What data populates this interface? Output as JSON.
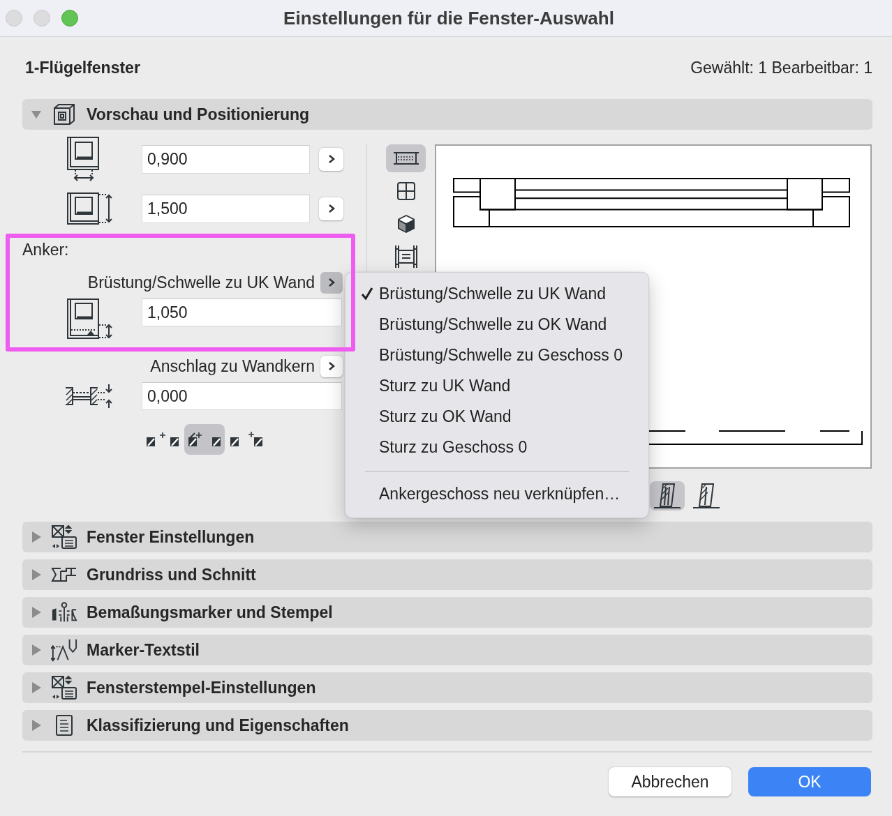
{
  "window": {
    "title": "Einstellungen für die Fenster-Auswahl",
    "buttons": [
      {
        "kind": "close",
        "enabled": false
      },
      {
        "kind": "minimize",
        "enabled": false
      },
      {
        "kind": "zoom",
        "enabled": true
      }
    ]
  },
  "header": {
    "element_name": "1-Flügelfenster",
    "selection_info": "Gewählt: 1 Bearbeitbar: 1"
  },
  "sections": [
    {
      "title": "Vorschau und Positionierung",
      "expanded": true
    },
    {
      "title": "Fenster Einstellungen",
      "expanded": false
    },
    {
      "title": "Grundriss und Schnitt",
      "expanded": false
    },
    {
      "title": "Bemaßungsmarker und Stempel",
      "expanded": false
    },
    {
      "title": "Marker-Textstil",
      "expanded": false
    },
    {
      "title": "Fensterstempel-Einstellungen",
      "expanded": false
    },
    {
      "title": "Klassifizierung und Eigenschaften",
      "expanded": false
    }
  ],
  "positioning": {
    "width": {
      "value": "0,900"
    },
    "height": {
      "value": "1,500"
    },
    "anchor": {
      "label": "Anker:",
      "mode": "Brüstung/Schwelle zu UK Wand",
      "menu_open": true,
      "value": "1,050"
    },
    "reveal": {
      "mode": "Anschlag zu Wandkern",
      "menu_open": false,
      "value": "0,000",
      "options": [
        {
          "selected": false
        },
        {
          "selected": true
        },
        {
          "selected": false
        }
      ]
    }
  },
  "view_modes": [
    {
      "selected": true
    },
    {
      "selected": false
    },
    {
      "selected": false
    },
    {
      "selected": false
    }
  ],
  "orientation_options": [
    {
      "selected": true
    },
    {
      "selected": false
    }
  ],
  "anchor_menu": {
    "items": [
      {
        "label": "Brüstung/Schwelle zu UK Wand",
        "checked": true
      },
      {
        "label": "Brüstung/Schwelle zu OK Wand",
        "checked": false
      },
      {
        "label": "Brüstung/Schwelle zu Geschoss 0",
        "checked": false
      },
      {
        "label": "Sturz zu UK Wand",
        "checked": false
      },
      {
        "label": "Sturz zu OK Wand",
        "checked": false
      },
      {
        "label": "Sturz zu Geschoss 0",
        "checked": false
      }
    ],
    "action": "Ankergeschoss neu verknüpfen…"
  },
  "buttons": [
    {
      "label": "Abbrechen",
      "default": false
    },
    {
      "label": "OK",
      "default": true
    }
  ]
}
